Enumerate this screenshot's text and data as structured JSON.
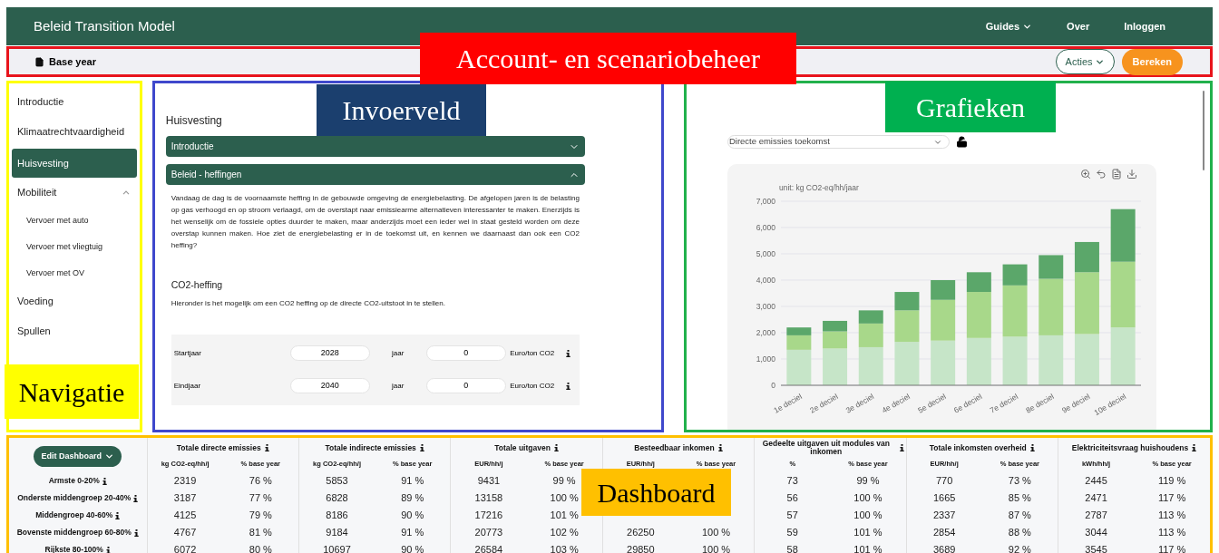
{
  "header": {
    "title": "Beleid Transition Model",
    "menu": [
      {
        "label": "Guides",
        "kind": "dropdown"
      },
      {
        "label": "Over",
        "kind": "link"
      },
      {
        "label": "Inloggen",
        "kind": "link"
      }
    ]
  },
  "scenario_bar": {
    "scenario": "Base year",
    "buttons": [
      {
        "label": "Acties",
        "kind": "dropdown"
      },
      {
        "label": "Bereken",
        "kind": "primary"
      }
    ]
  },
  "navigation": {
    "items": [
      {
        "label": "Introductie",
        "selected": false
      },
      {
        "label": "Klimaatrechtvaardigheid",
        "selected": false
      },
      {
        "label": "Huisvesting",
        "selected": true
      },
      {
        "label": "Mobiliteit",
        "selected": false,
        "expanded": true,
        "children": [
          {
            "label": "Vervoer met auto",
            "selected": false
          },
          {
            "label": "Vervoer met vliegtuig",
            "selected": false
          },
          {
            "label": "Vervoer met OV",
            "selected": false
          }
        ]
      },
      {
        "label": "Voeding",
        "selected": false
      },
      {
        "label": "Spullen",
        "selected": false
      }
    ]
  },
  "input_panel": {
    "title": "Huisvesting",
    "sections": [
      {
        "label": "Introductie",
        "expanded": false
      },
      {
        "label": "Beleid - heffingen",
        "expanded": true,
        "text": "Vandaag de dag is de voornaamste heffing in de gebouwde omgeving de energiebelasting. De afgelopen jaren is de belasting op gas verhoogd en op stroom verlaagd, om de overstapt naar emissiearme alternatieven interessanter te maken. Enerzijds is het wenselijk om de fossiele opties duurder te maken, maar anderzijds moet een ieder wel in staat gesteld worden om deze overstap kunnen maken. Hoe ziet de energiebelasting er in de toekomst uit, en kennen we daarnaast dan ook een CO2 heffing?",
        "subsection": {
          "title": "CO2-heffing",
          "description": "Hieronder is het mogelijk om een CO2 heffing op de directe CO2-uitstoot in te stellen.",
          "rows": [
            {
              "label": "Startjaar",
              "value": "2028",
              "unit": "jaar",
              "value_2": "0",
              "unit_2": "Euro/ton CO2"
            },
            {
              "label": "Eindjaar",
              "value": "2040",
              "unit": "jaar",
              "value_2": "0",
              "unit_2": "Euro/ton CO2"
            }
          ]
        }
      }
    ]
  },
  "charts_panel": {
    "selector": "Directe emissies toekomst",
    "locked": false,
    "chart_data": {
      "type": "bar",
      "stacked": true,
      "grid": true,
      "ylabel": "unit: kg CO2-eq/hh/jaar",
      "categories": [
        "1e deciel",
        "2e deciel",
        "3e deciel",
        "4e deciel",
        "5e deciel",
        "6e deciel",
        "7e deciel",
        "8e deciel",
        "9e deciel",
        "10e deciel"
      ],
      "ylim": [
        0,
        7000
      ],
      "yticks": [
        {
          "value": 0,
          "label": "0"
        },
        {
          "value": 1000,
          "label": "1,000"
        },
        {
          "value": 2000,
          "label": "2,000"
        },
        {
          "value": 3000,
          "label": "3,000"
        },
        {
          "value": 4000,
          "label": "4,000"
        },
        {
          "value": 5000,
          "label": "5,000"
        },
        {
          "value": 6000,
          "label": "6,000"
        },
        {
          "value": 7000,
          "label": "7,000"
        }
      ],
      "series": [
        {
          "color": "#c6e5c8",
          "values": [
            1350,
            1400,
            1450,
            1650,
            1700,
            1800,
            1850,
            1900,
            1950,
            2200
          ]
        },
        {
          "color": "#a8d88a",
          "values": [
            550,
            650,
            900,
            1200,
            1550,
            1750,
            1950,
            2150,
            2350,
            2500
          ]
        },
        {
          "color": "#5ba76a",
          "values": [
            300,
            400,
            500,
            700,
            750,
            750,
            800,
            900,
            1150,
            2000
          ]
        }
      ]
    }
  },
  "dashboard": {
    "edit_button": "Edit Dashboard",
    "columns": [
      {
        "title": "Totale directe emissies",
        "units": [
          "kg CO2-eq/hh/j",
          "% base year"
        ]
      },
      {
        "title": "Totale indirecte emissies",
        "units": [
          "kg CO2-eq/hh/j",
          "% base year"
        ]
      },
      {
        "title": "Totale uitgaven",
        "units": [
          "EUR/hh/j",
          "% base year"
        ]
      },
      {
        "title": "Besteedbaar inkomen",
        "units": [
          "EUR/hh/j",
          "% base year"
        ]
      },
      {
        "title": "Gedeelte uitgaven uit modules van inkomen",
        "units": [
          "%",
          "% base year"
        ]
      },
      {
        "title": "Totale inkomsten overheid",
        "units": [
          "EUR/hh/j",
          "% base year"
        ]
      },
      {
        "title": "Elektriciteitsvraag huishoudens",
        "units": [
          "kWh/hh/j",
          "% base year"
        ]
      }
    ],
    "rows": [
      {
        "label": "Armste 0-20%",
        "groups": [
          {
            "kind": "values",
            "value": "2319",
            "percent": "76 %"
          },
          {
            "kind": "values",
            "value": "5853",
            "percent": "91 %"
          },
          {
            "kind": "values",
            "value": "9431",
            "percent": "99 %"
          },
          {
            "kind": "covered"
          },
          {
            "kind": "values",
            "value": "73",
            "percent": "99 %"
          },
          {
            "kind": "values",
            "value": "770",
            "percent": "73 %"
          },
          {
            "kind": "values",
            "value": "2445",
            "percent": "119 %"
          }
        ]
      },
      {
        "label": "Onderste middengroep 20-40%",
        "groups": [
          {
            "kind": "values",
            "value": "3187",
            "percent": "77 %"
          },
          {
            "kind": "values",
            "value": "6828",
            "percent": "89 %"
          },
          {
            "kind": "values",
            "value": "13158",
            "percent": "100 %"
          },
          {
            "kind": "covered"
          },
          {
            "kind": "values",
            "value": "56",
            "percent": "100 %"
          },
          {
            "kind": "values",
            "value": "1665",
            "percent": "85 %"
          },
          {
            "kind": "values",
            "value": "2471",
            "percent": "117 %"
          }
        ]
      },
      {
        "label": "Middengroep 40-60%",
        "groups": [
          {
            "kind": "values",
            "value": "4125",
            "percent": "79 %"
          },
          {
            "kind": "values",
            "value": "8186",
            "percent": "90 %"
          },
          {
            "kind": "values",
            "value": "17216",
            "percent": "101 %"
          },
          {
            "kind": "covered"
          },
          {
            "kind": "values",
            "value": "57",
            "percent": "100 %"
          },
          {
            "kind": "values",
            "value": "2337",
            "percent": "87 %"
          },
          {
            "kind": "values",
            "value": "2787",
            "percent": "113 %"
          }
        ]
      },
      {
        "label": "Bovenste middengroep 60-80%",
        "groups": [
          {
            "kind": "values",
            "value": "4767",
            "percent": "81 %"
          },
          {
            "kind": "values",
            "value": "9184",
            "percent": "91 %"
          },
          {
            "kind": "values",
            "value": "20773",
            "percent": "102 %"
          },
          {
            "kind": "values",
            "value": "26250",
            "percent": "100 %"
          },
          {
            "kind": "values",
            "value": "59",
            "percent": "101 %"
          },
          {
            "kind": "values",
            "value": "2854",
            "percent": "88 %"
          },
          {
            "kind": "values",
            "value": "3044",
            "percent": "113 %"
          }
        ]
      },
      {
        "label": "Rijkste 80-100%",
        "groups": [
          {
            "kind": "values",
            "value": "6072",
            "percent": "80 %"
          },
          {
            "kind": "values",
            "value": "10697",
            "percent": "90 %"
          },
          {
            "kind": "values",
            "value": "26584",
            "percent": "103 %"
          },
          {
            "kind": "values",
            "value": "29850",
            "percent": "100 %"
          },
          {
            "kind": "values",
            "value": "58",
            "percent": "101 %"
          },
          {
            "kind": "values",
            "value": "3689",
            "percent": "92 %"
          },
          {
            "kind": "values",
            "value": "3545",
            "percent": "117 %"
          }
        ]
      }
    ]
  },
  "annotations": [
    {
      "text": "Account- en scenariobeheer",
      "color": "#ff0000"
    },
    {
      "text": "Invoerveld",
      "color": "#1b3f6e"
    },
    {
      "text": "Grafieken",
      "color": "#00b050"
    },
    {
      "text": "Navigatie",
      "color": "#ffff00"
    },
    {
      "text": "Dashboard",
      "color": "#ffc000"
    }
  ]
}
